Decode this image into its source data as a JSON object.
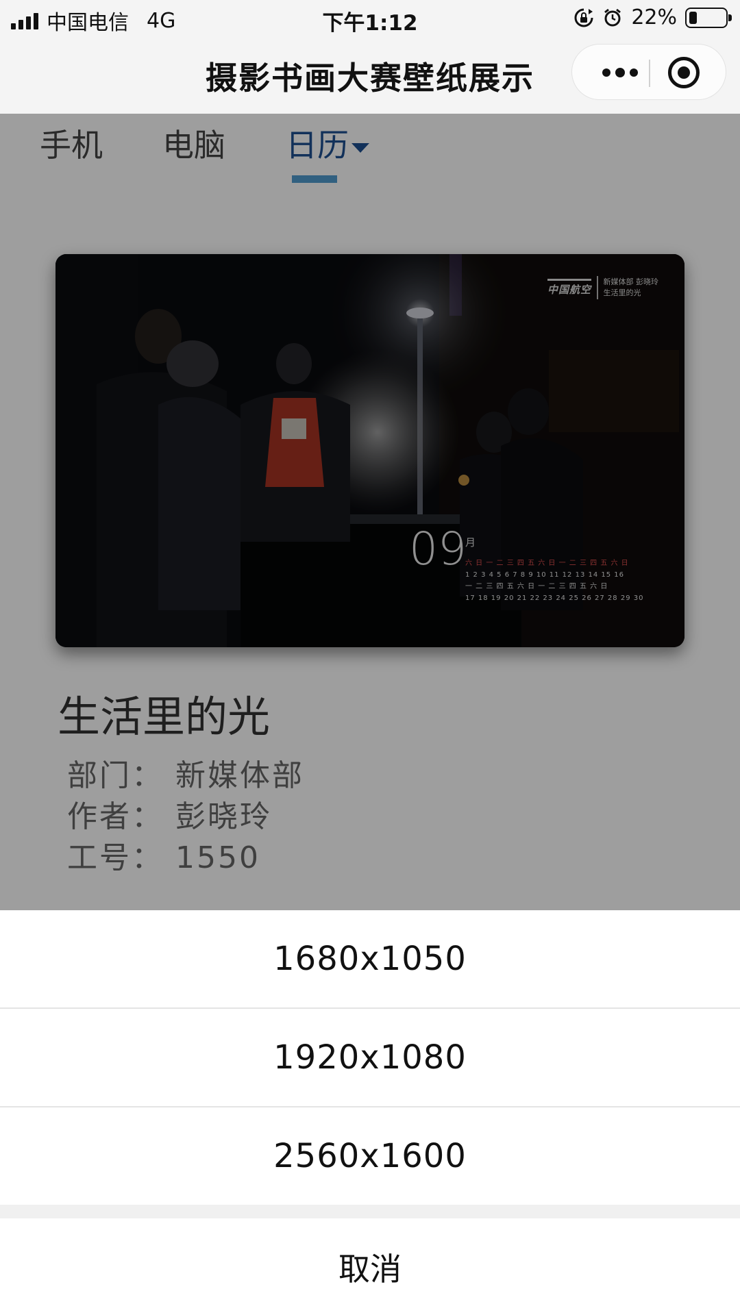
{
  "status_bar": {
    "carrier": "中国电信",
    "network": "4G",
    "time": "下午1:12",
    "battery_percent": "22%",
    "battery_level": 0.22
  },
  "nav": {
    "title": "摄影书画大赛壁纸展示"
  },
  "tabs": [
    {
      "label": "手机"
    },
    {
      "label": "电脑"
    },
    {
      "label": "日历"
    }
  ],
  "active_tab": "日历",
  "wallpaper": {
    "logo_text": "中国航空",
    "logo_meta_1": "新媒体部  彭晓玲",
    "logo_meta_2": "生活里的光",
    "month": "09",
    "month_unit": "月",
    "cal_weekdays": "六 日 一 二 三 四 五 六 日 一 二 三 四 五 六 日",
    "cal_days_1": "1  2  3  4  5  6  7  8  9 10 11 12 13 14 15 16",
    "cal_weekdays_2": "一 二 三 四 五 六 日 一 二 三 四 五 六 日",
    "cal_days_2": "17 18 19 20 21 22 23 24 25 26 27 28 29 30"
  },
  "artwork": {
    "title": "生活里的光",
    "department": "部门：  新媒体部",
    "author": "作者：  彭晓玲",
    "employee_id": "工号：  1550"
  },
  "action_sheet": {
    "options": [
      {
        "label": "1680x1050"
      },
      {
        "label": "1920x1080"
      },
      {
        "label": "2560x1600"
      }
    ],
    "cancel": "取消"
  },
  "colors": {
    "accent": "#1d4f91",
    "tab_indicator": "#4f9ccf",
    "mask": "rgba(0,0,0,0.38)"
  }
}
